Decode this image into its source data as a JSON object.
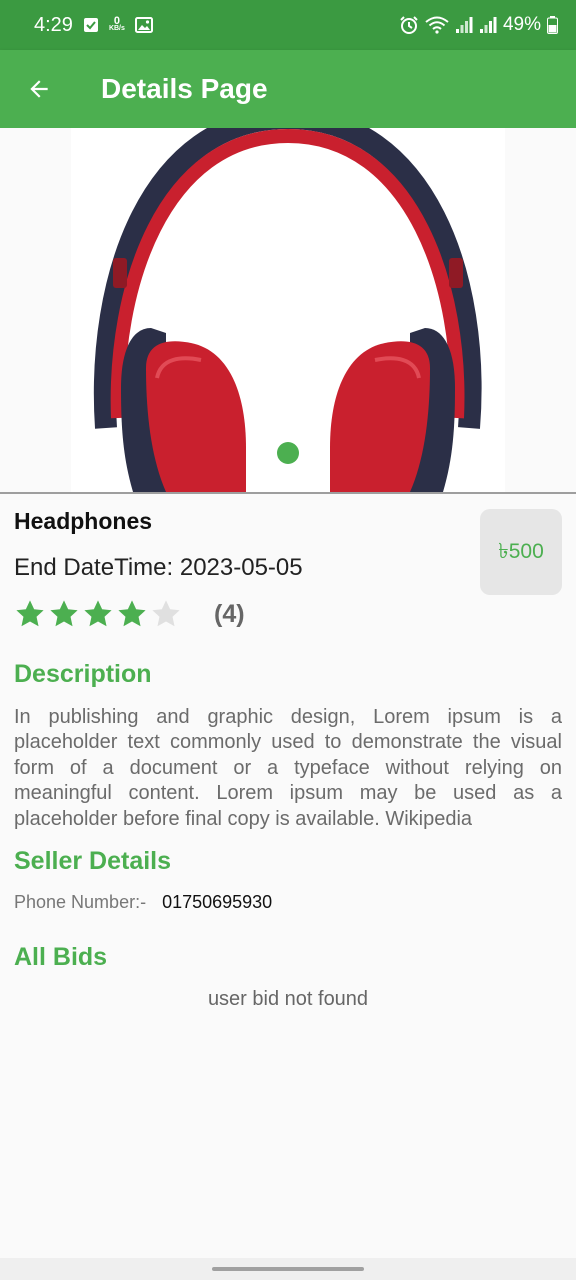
{
  "status_bar": {
    "time": "4:29",
    "data_speed_value": "0",
    "data_speed_unit": "KB/s",
    "battery_text": "49%",
    "icons": [
      "checkbox-icon",
      "data-speed-icon",
      "image-icon",
      "alarm-icon",
      "wifi-icon",
      "signal-icon",
      "signal-icon",
      "battery-icon"
    ]
  },
  "app_bar": {
    "back_icon": "arrow-back-icon",
    "title": "Details Page"
  },
  "product": {
    "image_icon": "headphones-image",
    "carousel_page": 1,
    "name": "Headphones",
    "end_datetime": "End DateTime: 2023-05-05",
    "price": "৳500",
    "rating": 4,
    "rating_max": 5,
    "rating_count": "(4)"
  },
  "description": {
    "heading": "Description",
    "text": "In publishing and graphic design, Lorem ipsum is a placeholder text commonly used to demonstrate the visual form of a document or a typeface without relying on meaningful content. Lorem ipsum may be used as a placeholder before final copy is available. Wikipedia"
  },
  "seller": {
    "heading": "Seller Details",
    "phone_label": "Phone Number:-",
    "phone_value": "01750695930"
  },
  "bids": {
    "heading": "All Bids",
    "empty_text": "user bid not found"
  },
  "colors": {
    "primary": "#4caf50",
    "status_bar": "#3b9a41",
    "headphone_red": "#c9202e",
    "headphone_dark": "#2b2f47"
  }
}
